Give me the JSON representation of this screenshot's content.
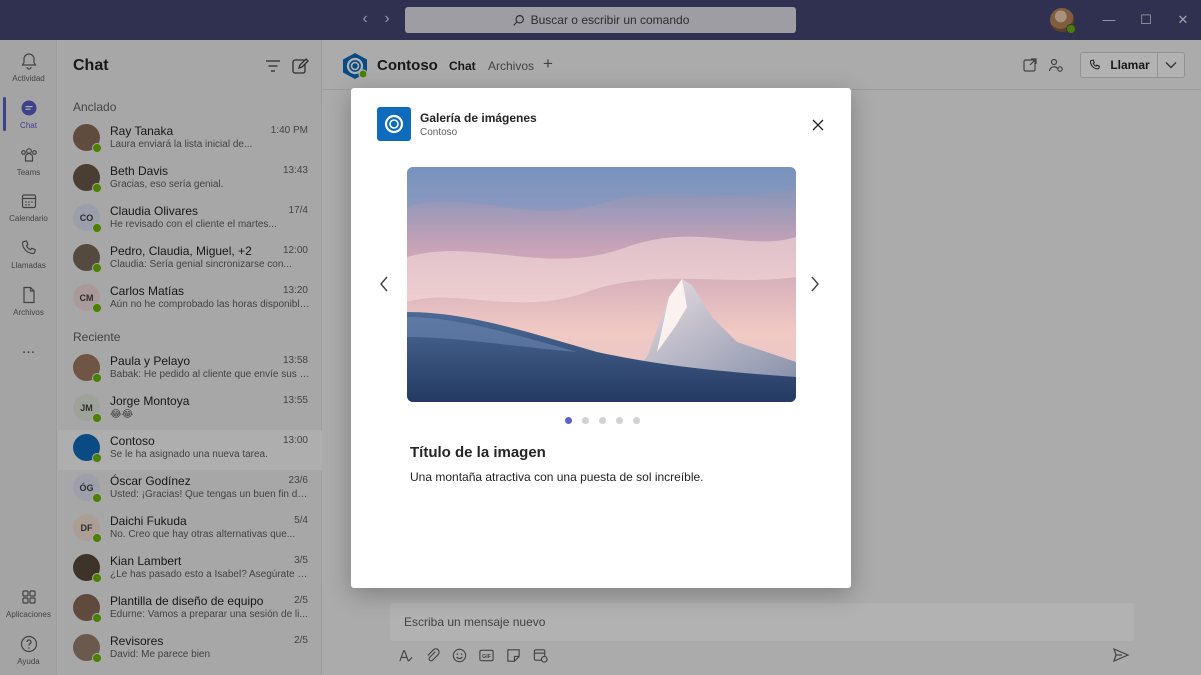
{
  "titlebar": {
    "search_placeholder": "Buscar o escribir un comando",
    "accent": "#464775"
  },
  "rail": {
    "items": [
      {
        "label": "Actividad",
        "icon": "bell-icon"
      },
      {
        "label": "Chat",
        "icon": "chat-icon"
      },
      {
        "label": "Teams",
        "icon": "teams-icon"
      },
      {
        "label": "Calendario",
        "icon": "calendar-icon"
      },
      {
        "label": "Llamadas",
        "icon": "phone-icon"
      },
      {
        "label": "Archivos",
        "icon": "file-icon"
      }
    ],
    "more": "...",
    "bottom": [
      {
        "label": "Aplicaciones",
        "icon": "apps-icon"
      },
      {
        "label": "Ayuda",
        "icon": "help-icon"
      }
    ]
  },
  "chatlist": {
    "title": "Chat",
    "pinned_label": "Anclado",
    "recent_label": "Reciente",
    "pinned": [
      {
        "name": "Ray Tanaka",
        "time": "1:40 PM",
        "preview": "Laura enviará la lista inicial de...",
        "initials": "",
        "avatar_color": "#8a6e5a"
      },
      {
        "name": "Beth Davis",
        "time": "13:43",
        "preview": "Gracias, eso sería genial.",
        "initials": "",
        "avatar_color": "#6b5a4a"
      },
      {
        "name": "Claudia Olivares",
        "time": "17/4",
        "preview": "He revisado con el cliente el martes...",
        "initials": "CO",
        "avatar_color": "#dfe3f5"
      },
      {
        "name": "Pedro, Claudia, Miguel, +2",
        "time": "12:00",
        "preview": "Claudia: Sería genial sincronizarse con...",
        "initials": "",
        "avatar_color": "#7a6a5a"
      },
      {
        "name": "Carlos Matías",
        "time": "13:20",
        "preview": "Aún no he comprobado las horas disponibles",
        "initials": "CM",
        "avatar_color": "#f4dcdc"
      }
    ],
    "recent": [
      {
        "name": "Paula y Pelayo",
        "time": "13:58",
        "preview": "Babak: He pedido al cliente que envíe sus c...",
        "initials": "",
        "avatar_color": "#a07a60"
      },
      {
        "name": "Jorge Montoya",
        "time": "13:55",
        "preview": "😂😂",
        "initials": "JM",
        "avatar_color": "#e2eadc"
      },
      {
        "name": "Contoso",
        "time": "13:00",
        "preview": "Se le ha asignado una nueva tarea.",
        "initials": "",
        "avatar_color": "#0f6cbd"
      },
      {
        "name": "Óscar Godínez",
        "time": "23/6",
        "preview": "Usted: ¡Gracias! Que tengas un buen fin de ...",
        "initials": "ÓG",
        "avatar_color": "#e1e4f5"
      },
      {
        "name": "Daichi Fukuda",
        "time": "5/4",
        "preview": "No. Creo que hay otras alternativas que...",
        "initials": "DF",
        "avatar_color": "#f6e3d4"
      },
      {
        "name": "Kian Lambert",
        "time": "3/5",
        "preview": "¿Le has pasado esto a Isabel? Asegúrate de ...",
        "initials": "",
        "avatar_color": "#5a4a3a"
      },
      {
        "name": "Plantilla de diseño de equipo",
        "time": "2/5",
        "preview": "Edurne: Vamos a preparar una sesión de li...",
        "initials": "",
        "avatar_color": "#8a6a5a"
      },
      {
        "name": "Revisores",
        "time": "2/5",
        "preview": "David: Me parece bien",
        "initials": "",
        "avatar_color": "#9a8070"
      }
    ]
  },
  "main": {
    "title": "Contoso",
    "tabs": [
      {
        "label": "Chat",
        "active": true
      },
      {
        "label": "Archivos",
        "active": false
      }
    ],
    "add_tab": "+",
    "call_label": "Llamar",
    "compose_placeholder": "Escriba un mensaje nuevo"
  },
  "dialog": {
    "title": "Galería de imágenes",
    "subtitle": "Contoso",
    "image_title": "Título de la imagen",
    "image_description": "Una montaña atractiva con una puesta de sol increíble.",
    "dot_count": 5,
    "active_dot": 0,
    "accent": "#5b5fc7"
  }
}
